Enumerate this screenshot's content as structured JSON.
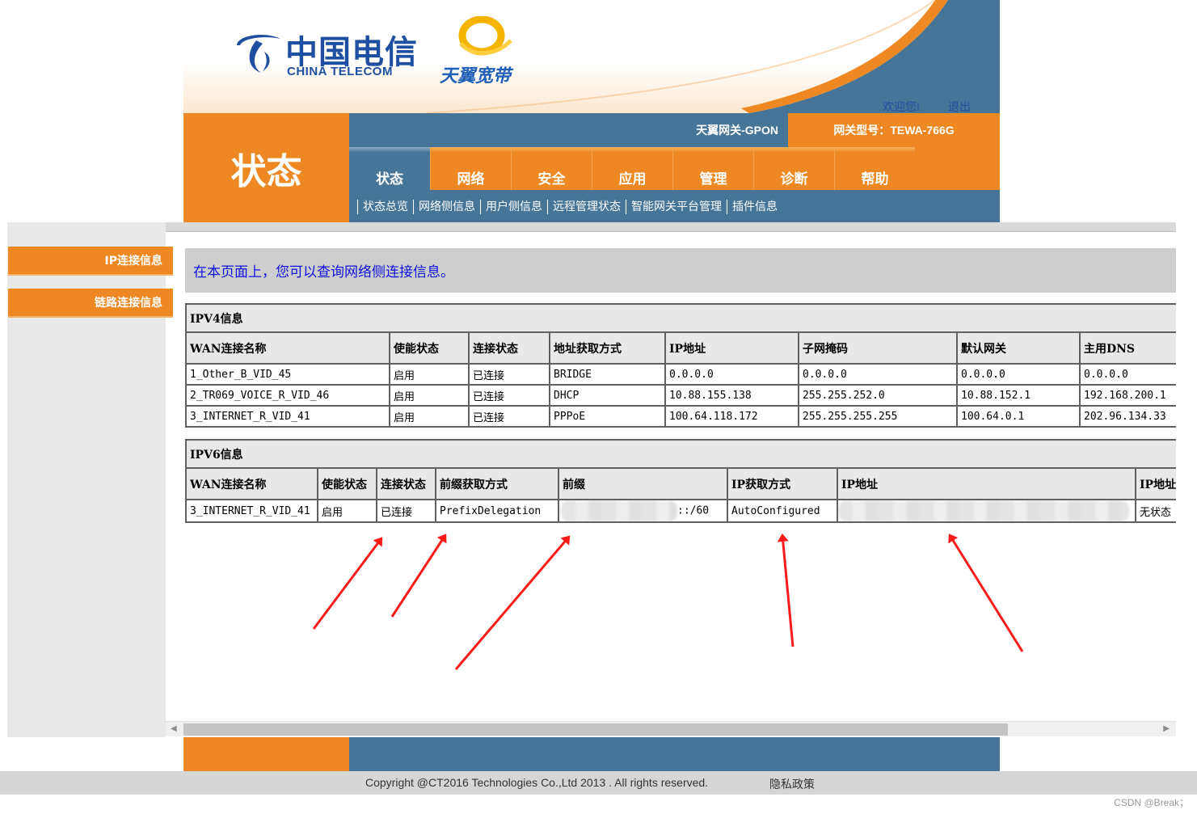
{
  "header": {
    "brand_cn": "中国电信",
    "brand_en": "CHINA TELECOM",
    "product": "天翼宽带",
    "welcome": "欢迎您!",
    "logout": "退出"
  },
  "gateway": {
    "name": "天翼网关-GPON",
    "model_label": "网关型号：",
    "model": "TEWA-766G"
  },
  "page_title": "状态",
  "tabs": [
    {
      "label": "状态",
      "active": true
    },
    {
      "label": "网络"
    },
    {
      "label": "安全"
    },
    {
      "label": "应用"
    },
    {
      "label": "管理"
    },
    {
      "label": "诊断"
    },
    {
      "label": "帮助"
    }
  ],
  "subnav": [
    {
      "label": "状态总览"
    },
    {
      "label": "网络侧信息",
      "active": true
    },
    {
      "label": "用户侧信息"
    },
    {
      "label": "远程管理状态"
    },
    {
      "label": "智能网关平台管理"
    },
    {
      "label": "插件信息"
    }
  ],
  "sidebar": [
    {
      "label": "IP连接信息"
    },
    {
      "label": "链路连接信息"
    }
  ],
  "intro": "在本页面上，您可以查询网络侧连接信息。",
  "ipv4": {
    "title": "IPV4信息",
    "columns": [
      "WAN连接名称",
      "使能状态",
      "连接状态",
      "地址获取方式",
      "IP地址",
      "子网掩码",
      "默认网关",
      "主用DNS"
    ],
    "rows": [
      [
        "1_Other_B_VID_45",
        "启用",
        "已连接",
        "BRIDGE",
        "0.0.0.0",
        "0.0.0.0",
        "0.0.0.0",
        "0.0.0.0"
      ],
      [
        "2_TR069_VOICE_R_VID_46",
        "启用",
        "已连接",
        "DHCP",
        "10.88.155.138",
        "255.255.252.0",
        "10.88.152.1",
        "192.168.200.1"
      ],
      [
        "3_INTERNET_R_VID_41",
        "启用",
        "已连接",
        "PPPoE",
        "100.64.118.172",
        "255.255.255.255",
        "100.64.0.1",
        "202.96.134.33"
      ]
    ]
  },
  "ipv6": {
    "title": "IPV6信息",
    "columns": [
      "WAN连接名称",
      "使能状态",
      "连接状态",
      "前缀获取方式",
      "前缀",
      "IP获取方式",
      "IP地址",
      "IP地址"
    ],
    "rows": [
      [
        "3_INTERNET_R_VID_41",
        "启用",
        "已连接",
        "PrefixDelegation",
        "::/60",
        "AutoConfigured",
        "",
        "无状态"
      ]
    ]
  },
  "footer": {
    "copyright": "Copyright @CT2016 Technologies Co.,Ltd 2013 . All rights reserved.",
    "privacy": "隐私政策"
  },
  "watermark": "CSDN @Break；",
  "colors": {
    "orange": "#ee8822",
    "blue": "#477597",
    "link_blue": "#1010e0",
    "arrow_red": "#ff1a1a"
  }
}
